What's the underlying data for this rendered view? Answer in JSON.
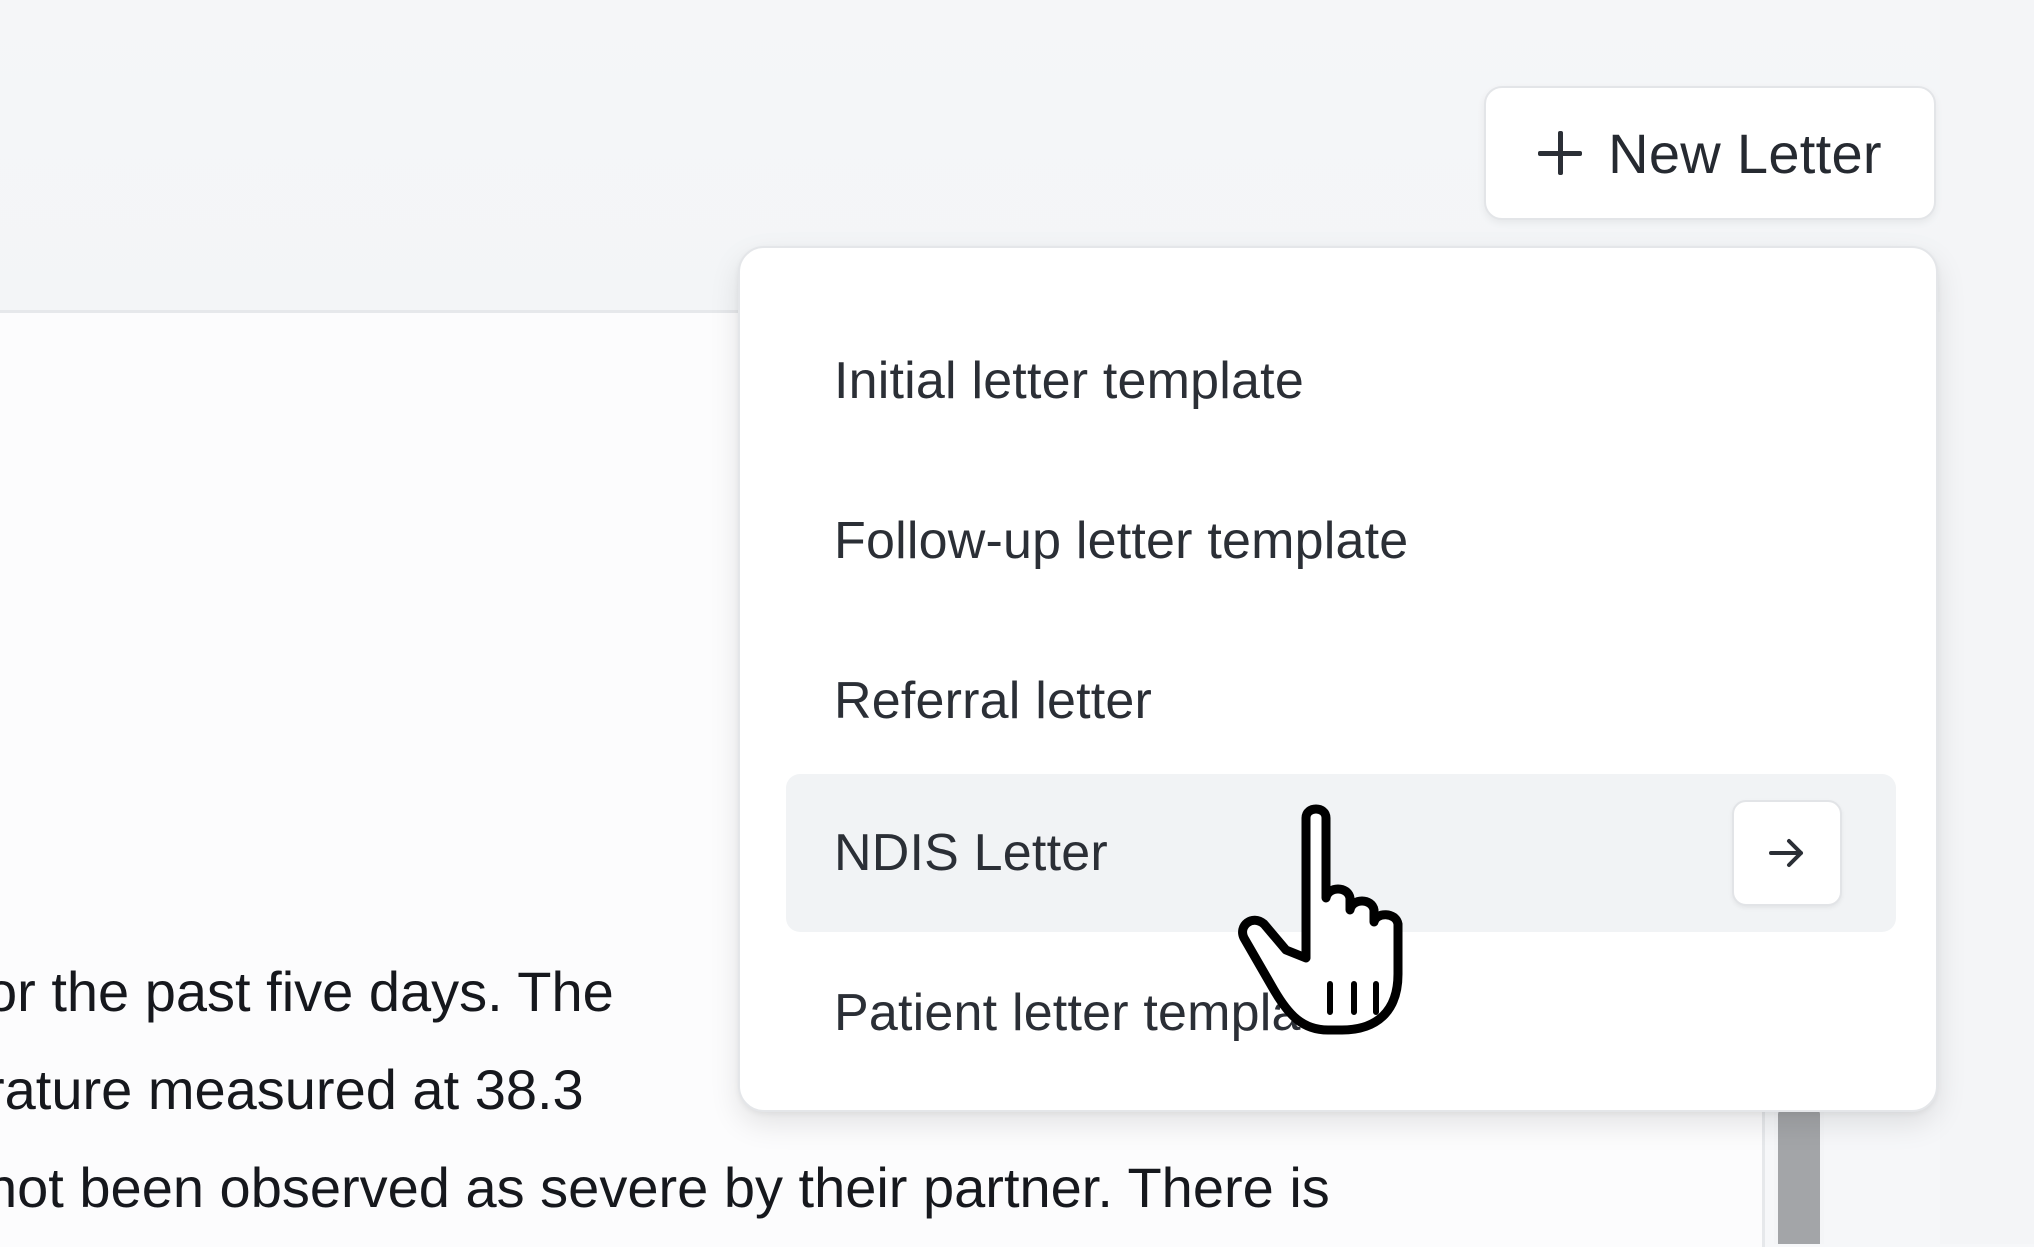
{
  "toolbar": {
    "new_letter_label": "New Letter",
    "new_letter_icon": "plus-icon"
  },
  "dropdown": {
    "items": [
      {
        "label": "Initial letter template"
      },
      {
        "label": "Follow-up letter template"
      },
      {
        "label": "Referral letter"
      },
      {
        "label": "NDIS Letter",
        "active": true,
        "action_icon": "arrow-right-icon"
      },
      {
        "label": "Patient letter template"
      }
    ]
  },
  "document": {
    "lines": [
      "or the past five days. The",
      "rature measured at 38.3",
      "not been observed as severe by their partner. There is"
    ]
  },
  "cursor": {
    "icon": "hand-pointer-icon"
  }
}
